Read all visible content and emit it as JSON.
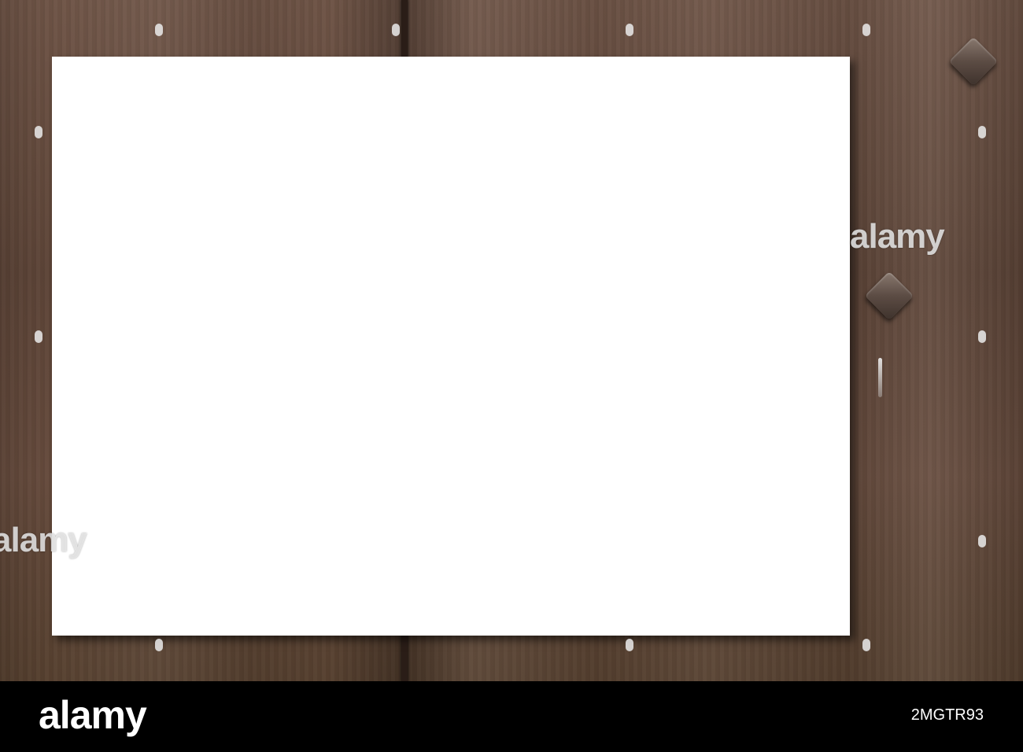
{
  "photo": {
    "subject": "blank white paper sheet on dark wooden planks with square nail heads",
    "wood_color": "#5e4538",
    "paper_color": "#ffffff"
  },
  "watermark": {
    "text": "alamy"
  },
  "footer": {
    "brand": "alamy",
    "image_id": "2MGTR93",
    "background": "#000000"
  }
}
